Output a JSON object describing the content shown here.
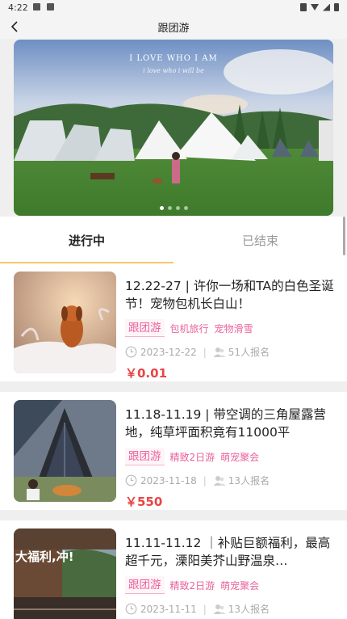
{
  "status_bar": {
    "time": "4:22"
  },
  "nav": {
    "title": "跟团游"
  },
  "banner": {
    "headline": "I LOVE WHO I AM",
    "subline": "i love who i will be",
    "slide_count": 4,
    "active_slide": 1
  },
  "tabs": [
    {
      "label": "进行中",
      "active": true
    },
    {
      "label": "已结束",
      "active": false
    }
  ],
  "trips": [
    {
      "title": "12.22-27 | 许你一场和TA的白色圣诞节！宠物包机长白山！",
      "main_tag": "跟团游",
      "sub_tags": [
        "包机旅行",
        "宠物滑雪"
      ],
      "date": "2023-12-22",
      "signups": "51人报名",
      "price": "￥0.01"
    },
    {
      "title": "11.18-11.19 | 带空调的三角屋露营地，纯草坪面积竟有11000平",
      "main_tag": "跟团游",
      "sub_tags": [
        "精致2日游",
        "萌宠聚会"
      ],
      "date": "2023-11-18",
      "signups": "13人报名",
      "price": "￥550"
    },
    {
      "title": "11.11-11.12 ｜补贴巨额福利，最高超千元，溧阳美芥山野温泉…",
      "main_tag": "跟团游",
      "sub_tags": [
        "精致2日游",
        "萌宠聚会"
      ],
      "date": "2023-11-11",
      "signups": "13人报名",
      "price": "",
      "thumb_text": "大福利,冲!"
    }
  ],
  "colors": {
    "accent_tab": "#f7c766",
    "tag_pink": "#e8629b",
    "price_red": "#e84545"
  }
}
